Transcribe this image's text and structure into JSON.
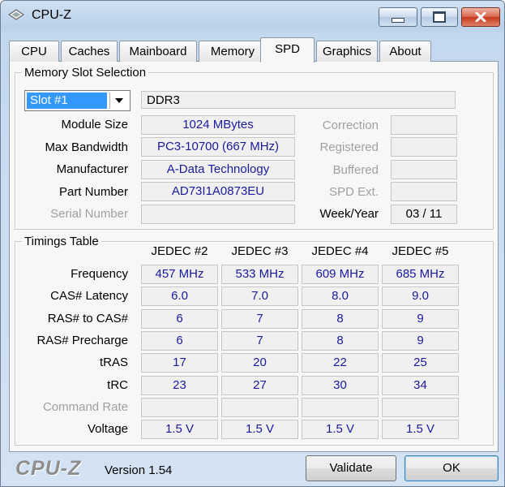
{
  "window": {
    "title": "CPU-Z"
  },
  "tabs": [
    "CPU",
    "Caches",
    "Mainboard",
    "Memory",
    "SPD",
    "Graphics",
    "About"
  ],
  "active_tab": "SPD",
  "slot_section": {
    "legend": "Memory Slot Selection",
    "selected_slot": "Slot #1",
    "memory_type": "DDR3",
    "module_size_label": "Module Size",
    "module_size": "1024 MBytes",
    "max_bandwidth_label": "Max Bandwidth",
    "max_bandwidth": "PC3-10700 (667 MHz)",
    "manufacturer_label": "Manufacturer",
    "manufacturer": "A-Data Technology",
    "part_number_label": "Part Number",
    "part_number": "AD73I1A0873EU",
    "serial_number_label": "Serial Number",
    "serial_number": "",
    "correction_label": "Correction",
    "registered_label": "Registered",
    "buffered_label": "Buffered",
    "spd_ext_label": "SPD Ext.",
    "week_year_label": "Week/Year",
    "week_year": "03 / 11"
  },
  "timings": {
    "legend": "Timings Table",
    "columns": [
      "JEDEC #2",
      "JEDEC #3",
      "JEDEC #4",
      "JEDEC #5"
    ],
    "rows": [
      {
        "label": "Frequency",
        "values": [
          "457 MHz",
          "533 MHz",
          "609 MHz",
          "685 MHz"
        ],
        "disabled": false
      },
      {
        "label": "CAS# Latency",
        "values": [
          "6.0",
          "7.0",
          "8.0",
          "9.0"
        ],
        "disabled": false
      },
      {
        "label": "RAS# to CAS#",
        "values": [
          "6",
          "7",
          "8",
          "9"
        ],
        "disabled": false
      },
      {
        "label": "RAS# Precharge",
        "values": [
          "6",
          "7",
          "8",
          "9"
        ],
        "disabled": false
      },
      {
        "label": "tRAS",
        "values": [
          "17",
          "20",
          "22",
          "25"
        ],
        "disabled": false
      },
      {
        "label": "tRC",
        "values": [
          "23",
          "27",
          "30",
          "34"
        ],
        "disabled": false
      },
      {
        "label": "Command Rate",
        "values": [
          "",
          "",
          "",
          ""
        ],
        "disabled": true
      },
      {
        "label": "Voltage",
        "values": [
          "1.5 V",
          "1.5 V",
          "1.5 V",
          "1.5 V"
        ],
        "disabled": false
      }
    ]
  },
  "footer": {
    "logo": "CPU-Z",
    "version": "Version 1.54",
    "validate_label": "Validate",
    "ok_label": "OK"
  },
  "colors": {
    "value_text": "#1a1aa0",
    "selection": "#3399ff",
    "close_button": "#c5381e"
  }
}
